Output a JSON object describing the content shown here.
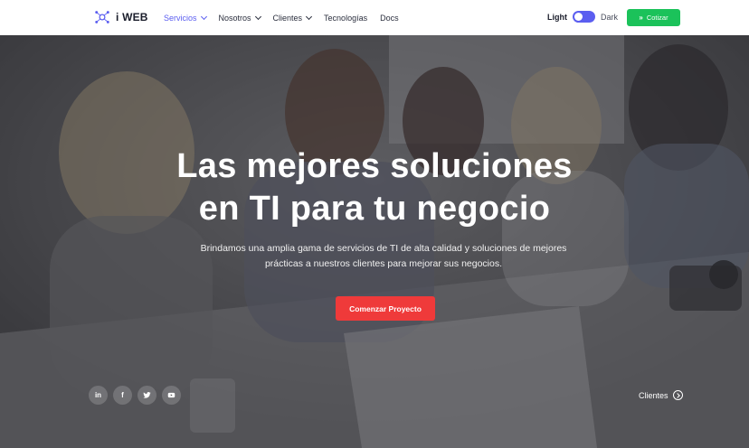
{
  "brand": {
    "name": "i WEB"
  },
  "nav": {
    "items": [
      {
        "label": "Servicios",
        "dropdown": true,
        "active": true
      },
      {
        "label": "Nosotros",
        "dropdown": true,
        "active": false
      },
      {
        "label": "Clientes",
        "dropdown": true,
        "active": false
      },
      {
        "label": "Tecnologías",
        "dropdown": false,
        "active": false
      },
      {
        "label": "Docs",
        "dropdown": false,
        "active": false
      }
    ]
  },
  "theme_toggle": {
    "light_label": "Light",
    "dark_label": "Dark",
    "state": "light"
  },
  "cta": {
    "label": "Cotizar",
    "icon": "double-chevron-right-icon"
  },
  "hero": {
    "title_line1": "Las mejores soluciones",
    "title_line2": "en TI para tu negocio",
    "subtitle": "Brindamos una amplia gama de servicios de TI de alta calidad y soluciones de mejores prácticas a nuestros clientes para mejorar sus negocios.",
    "button_label": "Comenzar Proyecto",
    "socials": [
      {
        "name": "linkedin-icon",
        "glyph": "in"
      },
      {
        "name": "facebook-icon",
        "glyph": "f"
      },
      {
        "name": "twitter-icon",
        "glyph": ""
      },
      {
        "name": "youtube-icon",
        "glyph": ""
      }
    ],
    "clients_link": "Clientes"
  },
  "colors": {
    "accent": "#5b5ef0",
    "cta_green": "#1bc25a",
    "hero_button_red": "#ef3a3a"
  }
}
